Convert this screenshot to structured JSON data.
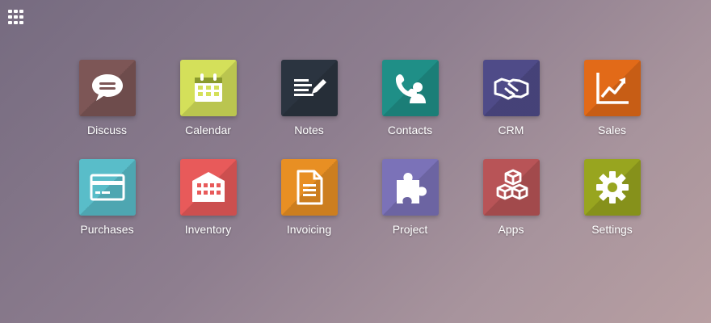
{
  "apps": [
    {
      "label": "Discuss",
      "icon": "speech-bubble-icon",
      "color": "#7d5656"
    },
    {
      "label": "Calendar",
      "icon": "calendar-icon",
      "color": "#d4e05a"
    },
    {
      "label": "Notes",
      "icon": "notes-pencil-icon",
      "color": "#2b3440"
    },
    {
      "label": "Contacts",
      "icon": "contact-phone-icon",
      "color": "#1f8f87"
    },
    {
      "label": "CRM",
      "icon": "handshake-icon",
      "color": "#4f4b88"
    },
    {
      "label": "Sales",
      "icon": "trend-chart-icon",
      "color": "#e26a18"
    },
    {
      "label": "Purchases",
      "icon": "credit-card-icon",
      "color": "#59bdc9"
    },
    {
      "label": "Inventory",
      "icon": "warehouse-icon",
      "color": "#e85a5a"
    },
    {
      "label": "Invoicing",
      "icon": "document-icon",
      "color": "#e88f23"
    },
    {
      "label": "Project",
      "icon": "puzzle-icon",
      "color": "#7b72b8"
    },
    {
      "label": "Apps",
      "icon": "cubes-icon",
      "color": "#b85457"
    },
    {
      "label": "Settings",
      "icon": "gear-icon",
      "color": "#98a51f"
    }
  ]
}
